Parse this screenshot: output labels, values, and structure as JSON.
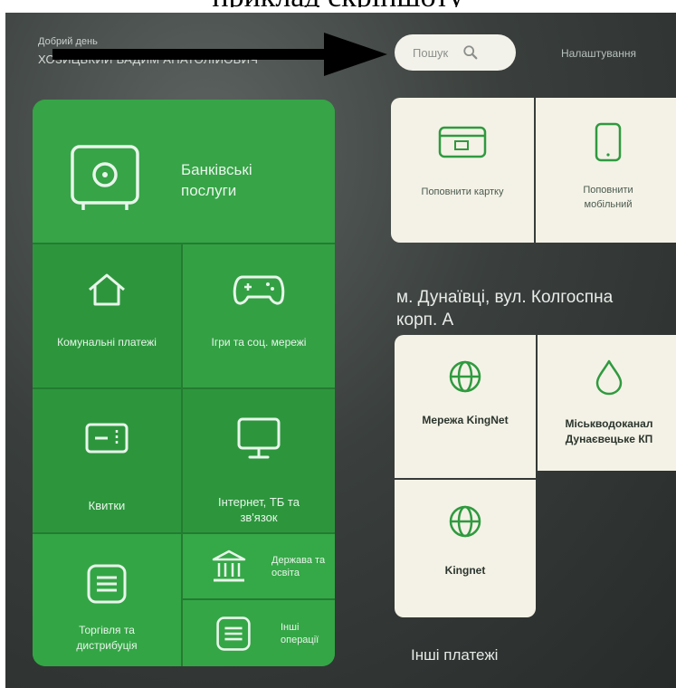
{
  "caption": "приклад скріншоту",
  "header": {
    "user_label": "Добрий день",
    "user_name": "ХОЗИЦЬКИЙ ВАДИМ АНАТОЛІЙОВИЧ",
    "search_placeholder": "Пошук",
    "settings_label": "Налаштування"
  },
  "categories": {
    "bank": "Банківські послуги",
    "utilities": "Комунальні платежі",
    "games": "Ігри та соц. мережі",
    "tickets": "Квитки",
    "internet": "Інтернет, ТБ та зв'язок",
    "trade": "Торгівля та дистрибуція",
    "gov": "Держава та освіта",
    "other_ops": "Інші операції"
  },
  "quick_actions": {
    "topup_card": "Поповнити картку",
    "topup_mobile": "Поповнити мобільний"
  },
  "address": {
    "line1": "м. Дунаївці, вул. Колгоспна",
    "line2": "корп. А"
  },
  "providers": [
    {
      "label": "Мережа KingNet",
      "icon": "globe-icon"
    },
    {
      "label": "Міськводоканал Дунаєвецьке КП",
      "icon": "water-drop-icon"
    },
    {
      "label": "Kingnet",
      "icon": "globe-icon"
    }
  ],
  "section_other": "Інші платежі",
  "colors": {
    "green_primary": "#2f9a3f",
    "card_bg": "#f4f2e6",
    "icon_green": "#2f9a3f"
  }
}
